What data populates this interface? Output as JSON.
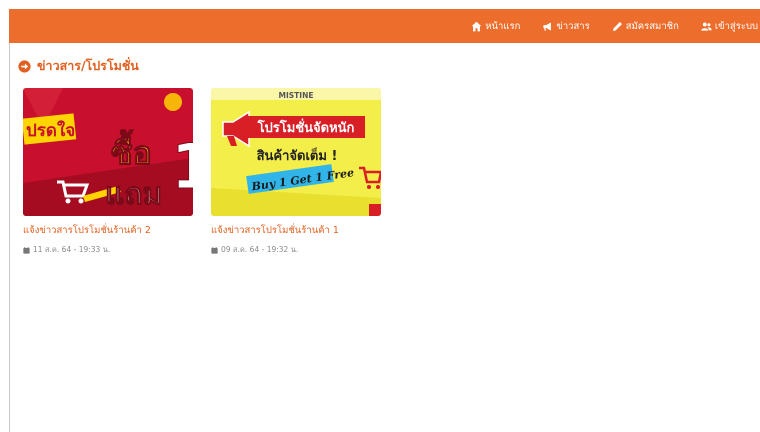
{
  "colors": {
    "header_bg": "#ec6d2c",
    "accent_text": "#e2601f",
    "date_text": "#8a8a8a"
  },
  "nav": {
    "items": [
      {
        "label": "หน้าแรก",
        "icon": "home-icon"
      },
      {
        "label": "ข่าวสาร",
        "icon": "bullhorn-icon"
      },
      {
        "label": "สมัครสมาชิก",
        "icon": "pencil-icon"
      },
      {
        "label": "เข้าสู่ระบบ",
        "icon": "users-icon"
      }
    ]
  },
  "section": {
    "title": "ข่าวสาร/โปรโมชั่น",
    "icon": "circle-arrow-right-icon"
  },
  "news": [
    {
      "title": "แจ้งข่าวสารโปรโมชั่นร้านค้า 2",
      "date": "11 ส.ค. 64 - 19:33 น.",
      "image": {
        "banner_left": "ปรดใจ",
        "headline_1": "ซื้อ",
        "headline_2": "แถม",
        "big_number": "1"
      }
    },
    {
      "title": "แจ้งข่าวสารโปรโมชั่นร้านค้า 1",
      "date": "09 ส.ค. 64 - 19:32 น.",
      "image": {
        "brand": "MISTINE",
        "banner": "โปรโมชั่นจัดหนัก",
        "subtitle": "สินค้าจัดเต็ม !",
        "tagline": "Buy 1 Get 1 Free"
      }
    }
  ]
}
